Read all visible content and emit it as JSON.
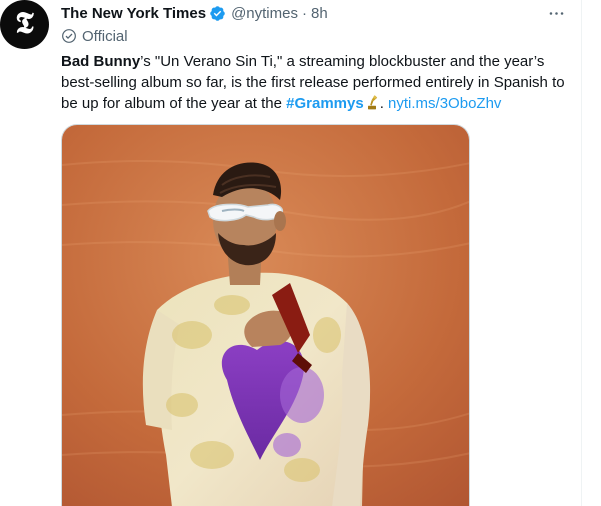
{
  "tweet": {
    "author_name": "The New York Times",
    "handle": "@nytimes",
    "separator": "·",
    "timestamp": "8h",
    "badge_label": "Official",
    "text": {
      "segment_1_bold": "Bad Bunny",
      "segment_2": "’s \"Un Verano Sin Ti,\" a streaming blockbuster and the year’s best-selling album so far, is the first release performed entirely in Spanish to be up for album of the year at the ",
      "hashtag": "#Grammys",
      "segment_3": ". ",
      "link": "nyti.ms/3OboZhv"
    },
    "icons": {
      "avatar": "nyt-logo-icon",
      "verified": "verified-badge-icon",
      "official": "official-label-icon",
      "more": "more-options-icon",
      "emoji": "trophy-emoji-icon"
    },
    "colors": {
      "link": "#1d9bf0",
      "verified": "#1d9bf0",
      "muted": "#536471"
    }
  }
}
